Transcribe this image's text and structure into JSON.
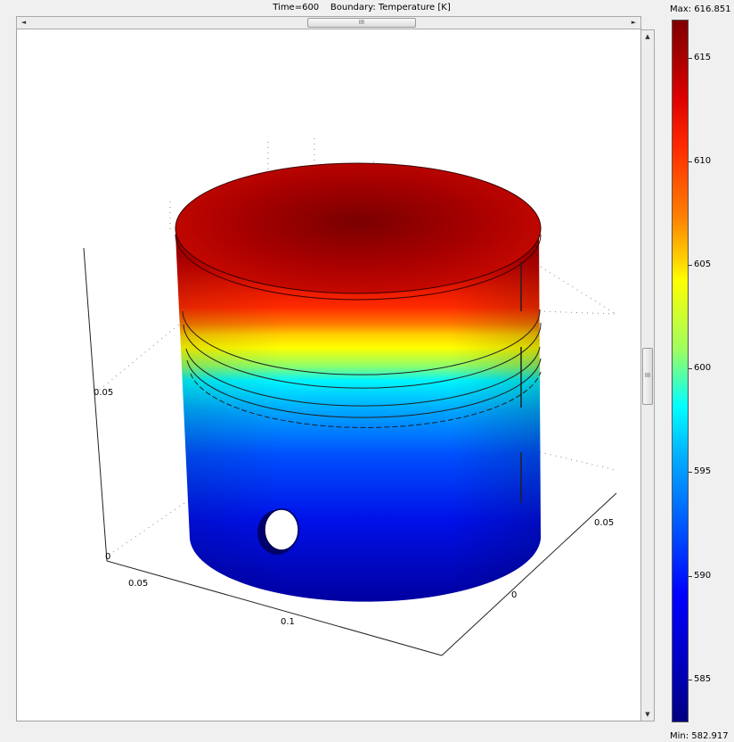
{
  "plot": {
    "title": "Time=600    Boundary: Temperature [K]"
  },
  "axes": {
    "z_tick_1": "0.05",
    "z_tick_0": "0",
    "x_tick_1": "0.05",
    "x_tick_2": "0.1",
    "y_tick_0": "0",
    "y_tick_1": "0.05"
  },
  "colorbar": {
    "max_label": "Max: 616.851",
    "min_label": "Min: 582.917",
    "max_value": 616.851,
    "min_value": 582.917,
    "ticks": [
      {
        "value": 615,
        "label": "615"
      },
      {
        "value": 610,
        "label": "610"
      },
      {
        "value": 605,
        "label": "605"
      },
      {
        "value": 600,
        "label": "600"
      },
      {
        "value": 595,
        "label": "595"
      },
      {
        "value": 590,
        "label": "590"
      },
      {
        "value": 585,
        "label": "585"
      }
    ],
    "colormap": "jet"
  },
  "scrollbars": {
    "h_thumb_grip": "III",
    "v_thumb_grip": "III",
    "left_arrow": "◄",
    "right_arrow": "►",
    "up_arrow": "▲",
    "down_arrow": "▼"
  }
}
